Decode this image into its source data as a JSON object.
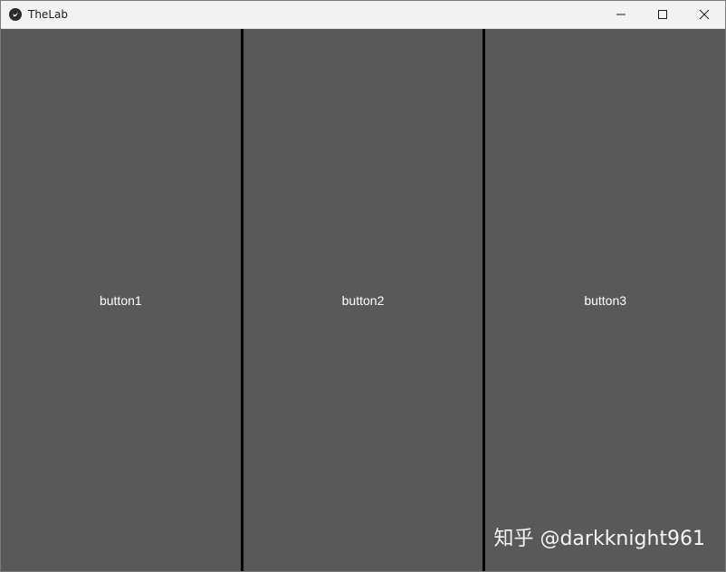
{
  "window": {
    "title": "TheLab",
    "controls": {
      "minimize": "minimize-icon",
      "maximize": "maximize-icon",
      "close": "close-icon"
    }
  },
  "buttons": [
    {
      "label": "button1"
    },
    {
      "label": "button2"
    },
    {
      "label": "button3"
    }
  ],
  "watermark": "知乎 @darkknight961",
  "colors": {
    "titlebar": "#f3f3f3",
    "button_bg": "#595959",
    "separator": "#000000",
    "button_text": "#ffffff"
  }
}
